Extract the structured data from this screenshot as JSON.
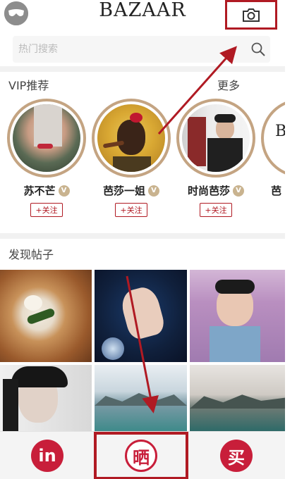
{
  "header": {
    "brand": "BAZAAR"
  },
  "search": {
    "placeholder": "热门搜索"
  },
  "vip": {
    "title": "VIP推荐",
    "more": "更多",
    "badge": "V",
    "users": [
      {
        "name": "苏不芒",
        "follow": "+关注"
      },
      {
        "name": "芭莎一姐",
        "follow": "+关注"
      },
      {
        "name": "时尚芭莎",
        "follow": "+关注"
      },
      {
        "name": "芭"
      }
    ]
  },
  "posts": {
    "title": "发现帖子"
  },
  "nav": {
    "tabs": [
      {
        "icon": "in"
      },
      {
        "icon": "晒"
      },
      {
        "icon": "买"
      }
    ]
  },
  "colors": {
    "accent": "#b01a23",
    "brand_red": "#c81e3a",
    "vip_ring": "#c4a482"
  }
}
